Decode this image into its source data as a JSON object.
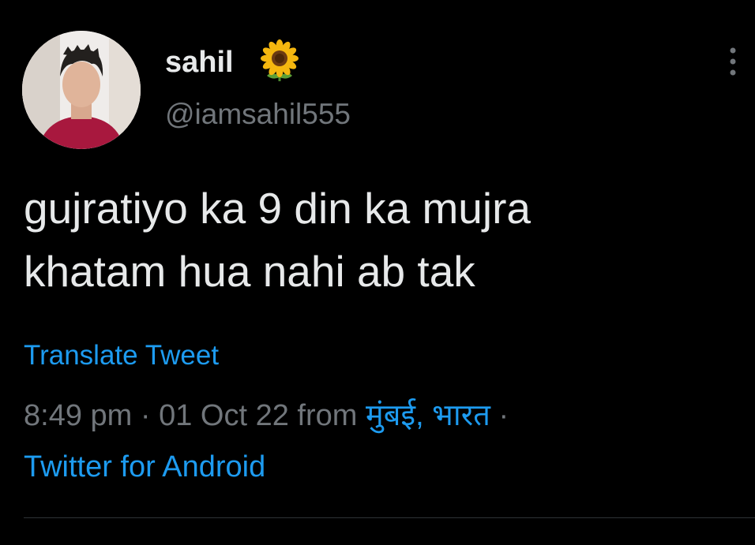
{
  "tweet": {
    "author": {
      "display_name": "sahil",
      "name_emoji": "sunflower-icon",
      "handle": "@iamsahil555"
    },
    "text_lines": [
      "gujratiyo ka 9 din ka mujra",
      "khatam hua nahi ab tak"
    ],
    "translate_label": "Translate Tweet",
    "time": "8:49 pm",
    "separator": "·",
    "date": "01 Oct 22",
    "from_label": "from",
    "location": "मुंबई, भारत",
    "source": "Twitter for Android"
  },
  "colors": {
    "background": "#000000",
    "primary_text": "#e7e9ea",
    "secondary_text": "#71767b",
    "link": "#1d9bf0",
    "divider": "#2f3336"
  }
}
